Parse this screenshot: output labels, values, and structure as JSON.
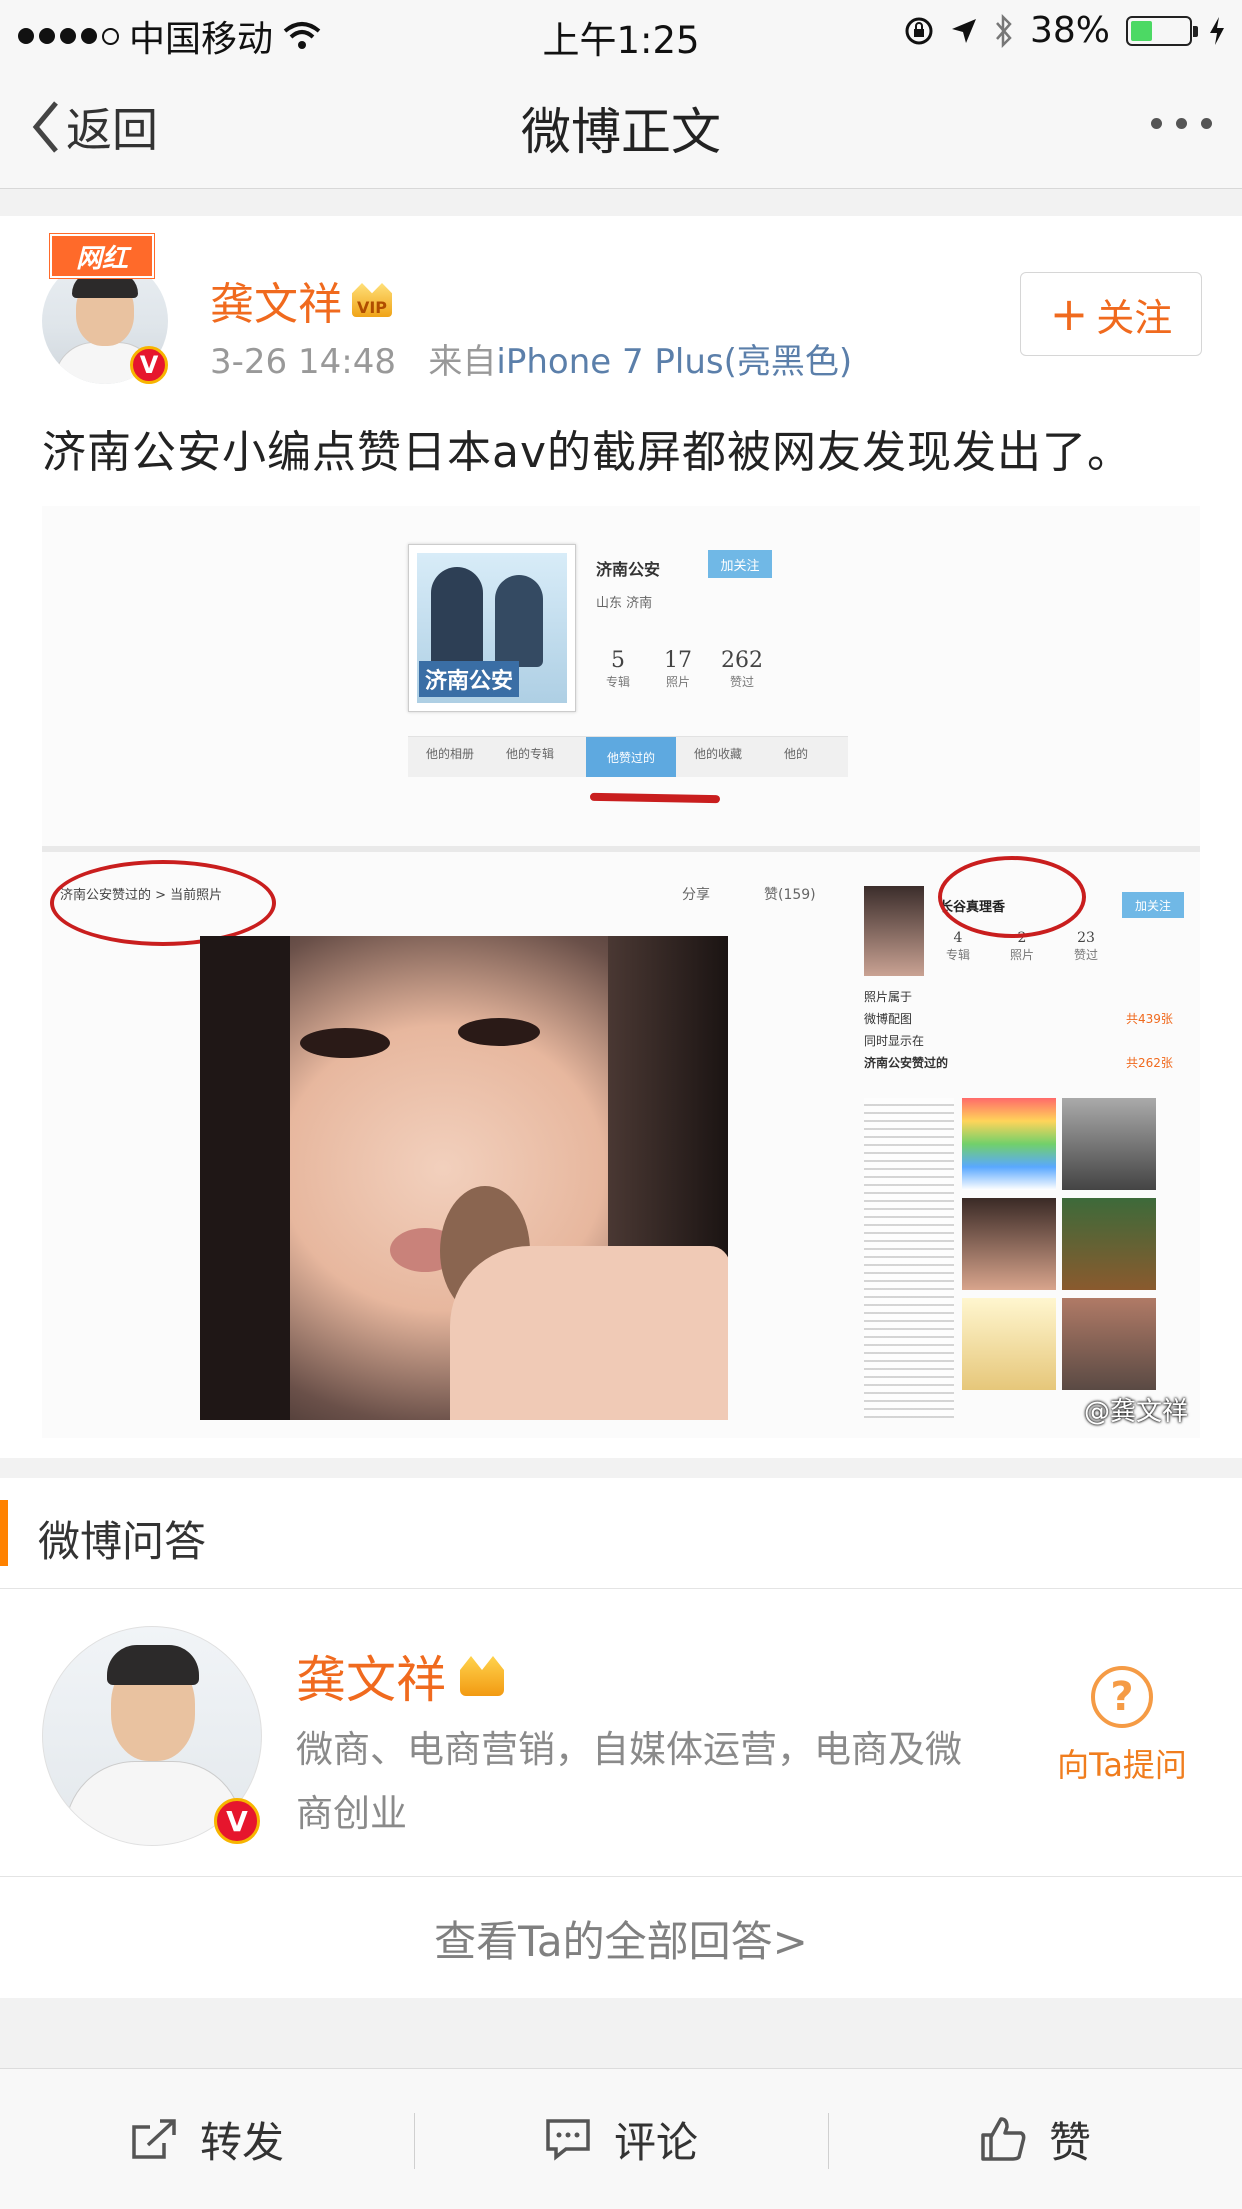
{
  "status_bar": {
    "carrier": "中国移动",
    "time": "上午1:25",
    "battery_pct_text": "38%",
    "battery_level": 0.38
  },
  "nav": {
    "back_label": "返回",
    "title": "微博正文"
  },
  "post": {
    "badge": "网红",
    "author": "龚文祥",
    "vip": "VIP",
    "time": "3-26 14:48",
    "source_prefix": "来自",
    "source": "iPhone 7 Plus(亮黑色)",
    "follow_label": "关注",
    "text": "济南公安小编点赞日本av的截屏都被网友发现发出了。",
    "image": {
      "profile_name": "济南公安",
      "profile_add": "加关注",
      "profile_loc": "山东 济南",
      "profile_pic_label": "济南公安",
      "stats": [
        {
          "n": "5",
          "l": "专辑"
        },
        {
          "n": "17",
          "l": "照片"
        },
        {
          "n": "262",
          "l": "赞过"
        }
      ],
      "tabs": [
        "他的相册",
        "他的专辑",
        "他赞过的",
        "他的收藏",
        "他的"
      ],
      "crumb": "济南公安赞过的 > 当前照片",
      "share": "分享",
      "like": "赞(159)",
      "side_name": "长谷真理香",
      "side_add": "加关注",
      "side_stats": [
        {
          "n": "4",
          "l": "专辑"
        },
        {
          "n": "2",
          "l": "照片"
        },
        {
          "n": "23",
          "l": "赞过"
        }
      ],
      "side_lines": [
        "照片属于",
        "微博配图",
        "同时显示在",
        "济南公安赞过的"
      ],
      "side_counts": [
        "共439张",
        "共262张"
      ],
      "watermark": "@龚文祥"
    }
  },
  "qa": {
    "section_title": "微博问答",
    "name": "龚文祥",
    "desc": "微商、电商营销，自媒体运营，电商及微商创业",
    "ask_label": "向Ta提问",
    "more_label": "查看Ta的全部回答>"
  },
  "tabbar": {
    "repost": "转发",
    "comment": "评论",
    "like": "赞"
  },
  "colors": {
    "accent": "#f06a1e",
    "qa_bar": "#ff8200",
    "link": "#5b7faa"
  }
}
